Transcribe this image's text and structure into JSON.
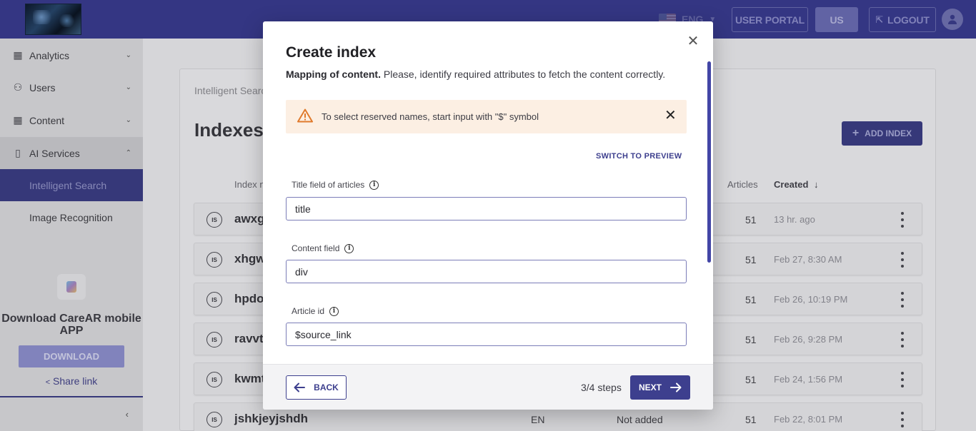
{
  "topbar": {
    "language": "ENG",
    "user_portal": "USER PORTAL",
    "region": "US",
    "logout": "LOGOUT"
  },
  "sidebar": {
    "items": [
      {
        "label": "Analytics",
        "icon": "table-icon",
        "chevron": "down"
      },
      {
        "label": "Users",
        "icon": "users-icon",
        "chevron": "down"
      },
      {
        "label": "Content",
        "icon": "table-icon",
        "chevron": "down"
      },
      {
        "label": "AI Services",
        "icon": "chip-icon",
        "chevron": "up"
      }
    ],
    "subitems": [
      {
        "label": "Intelligent Search",
        "active": true
      },
      {
        "label": "Image Recognition",
        "active": false
      }
    ],
    "promo": {
      "title": "Download CareAR mobile APP",
      "download": "DOWNLOAD",
      "share": "Share link"
    }
  },
  "main": {
    "breadcrumb": "Intelligent Search",
    "title": "Indexes",
    "add_button": "ADD INDEX",
    "columns": {
      "index": "Index n",
      "articles": "Articles",
      "created": "Created"
    },
    "rows": [
      {
        "name": "awxg",
        "articles": "51",
        "created": "13 hr. ago"
      },
      {
        "name": "xhgw",
        "articles": "51",
        "created": "Feb 27, 8:30 AM"
      },
      {
        "name": "hpdo",
        "articles": "51",
        "created": "Feb 26, 10:19 PM"
      },
      {
        "name": "ravvt",
        "articles": "51",
        "created": "Feb 26, 9:28 PM"
      },
      {
        "name": "kwmt",
        "articles": "51",
        "created": "Feb 24, 1:56 PM"
      },
      {
        "name": "jshkjeyjshdh",
        "lang": "EN",
        "status": "Not added",
        "articles": "51",
        "created": "Feb 22, 8:01 PM"
      }
    ],
    "badge": "IS"
  },
  "modal": {
    "title": "Create index",
    "subtitle_bold": "Mapping of content.",
    "subtitle_rest": " Please, identify required attributes to fetch the content correctly.",
    "alert": "To select reserved names, start input with \"$\" symbol",
    "switch_link": "SWITCH TO PREVIEW",
    "fields": [
      {
        "label": "Title field of articles",
        "value": "title"
      },
      {
        "label": "Content field",
        "value": "div"
      },
      {
        "label": "Article id",
        "value": "$source_link"
      }
    ],
    "back": "BACK",
    "steps": "3/4 steps",
    "next": "NEXT"
  },
  "colors": {
    "brand": "#393b8f",
    "accent": "#3d3f8e",
    "alert_bg": "#fcefe3",
    "warning": "#e07a2c"
  }
}
